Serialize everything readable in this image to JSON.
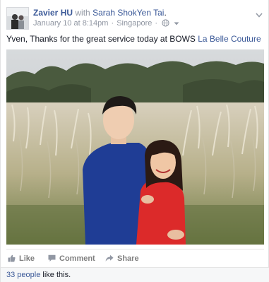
{
  "post": {
    "author": "Zavier HU",
    "with_word": "with",
    "tagged": "Sarah ShokYen Tai",
    "tagged_suffix": ".",
    "date": "January 10 at 8:14pm",
    "separator": "·",
    "location": "Singapore",
    "privacy_icon": "globe-icon",
    "message_text": "Yven, Thanks for the great service today at BOWS ",
    "message_link": "La Belle Couture",
    "photo_description_icon": "photo"
  },
  "actions": {
    "like_label": "Like",
    "comment_label": "Comment",
    "share_label": "Share"
  },
  "likes": {
    "people_link": "33 people",
    "suffix": " like this."
  },
  "colors": {
    "link": "#3b5998",
    "muted": "#9197a3",
    "action_gray": "#7f7f7f",
    "likes_bg": "#f6f7f8"
  }
}
